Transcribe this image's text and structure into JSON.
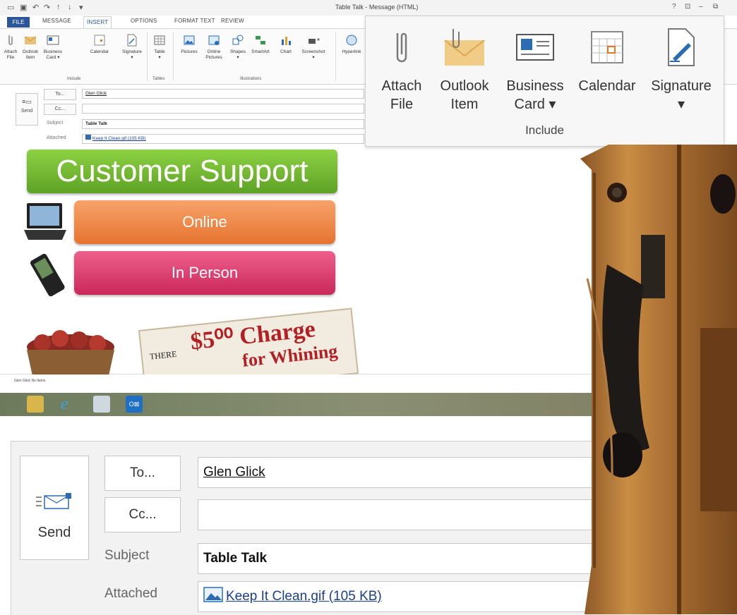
{
  "window": {
    "title": "Table Talk - Message (HTML)",
    "controls": [
      "?",
      "⊡",
      "–",
      "⧉"
    ]
  },
  "ribbon_tabs": [
    "FILE",
    "MESSAGE",
    "INSERT",
    "OPTIONS",
    "FORMAT TEXT",
    "REVIEW"
  ],
  "ribbon_small": {
    "include": [
      {
        "label": "Attach\nFile",
        "icon": "paperclip-icon"
      },
      {
        "label": "Outlook\nItem",
        "icon": "envelope-icon"
      },
      {
        "label": "Business\nCard ▾",
        "icon": "business-card-icon"
      },
      {
        "label": "Calendar",
        "icon": "calendar-icon"
      },
      {
        "label": "Signature\n▾",
        "icon": "signature-icon"
      }
    ],
    "include_group": "Include",
    "tables": [
      {
        "label": "Table\n▾",
        "icon": "table-icon"
      }
    ],
    "tables_group": "Tables",
    "illustrations": [
      {
        "label": "Pictures",
        "icon": "pictures-icon"
      },
      {
        "label": "Online\nPictures",
        "icon": "online-pictures-icon"
      },
      {
        "label": "Shapes\n▾",
        "icon": "shapes-icon"
      },
      {
        "label": "SmartArt",
        "icon": "smartart-icon"
      },
      {
        "label": "Chart",
        "icon": "chart-icon"
      },
      {
        "label": "Screenshot\n▾",
        "icon": "screenshot-icon"
      }
    ],
    "illustrations_group": "Illustrations",
    "hyperlink": "Hyperlink"
  },
  "callout_ribbon": {
    "buttons": [
      {
        "label": "Attach\nFile",
        "icon": "paperclip-icon"
      },
      {
        "label": "Outlook\nItem",
        "icon": "envelope-icon"
      },
      {
        "label": "Business\nCard ▾",
        "icon": "business-card-icon"
      },
      {
        "label": "Calendar",
        "icon": "calendar-icon"
      },
      {
        "label": "Signature\n▾",
        "icon": "signature-icon"
      }
    ],
    "group_label": "Include"
  },
  "header": {
    "send": "Send",
    "to_button": "To...",
    "cc_button": "Cc...",
    "to_value": "Glen Glick",
    "cc_value": "",
    "subject_label": "Subject",
    "subject_value": "Table Talk",
    "attached_label": "Attached",
    "attachment": "Keep It Clean.gif (105 KB)"
  },
  "message_body": {
    "banner": "Customer Support",
    "online": "Online",
    "in_person": "In Person",
    "sign_there": "THERE",
    "sign_amount": "$5⁰⁰ Charge",
    "sign_whining": "for Whining"
  },
  "status": {
    "text": "Glen Glick  No Items"
  },
  "colors": {
    "file_tab": "#2b579a",
    "banner_green": "#6fb32f",
    "online_orange": "#ef8a48",
    "in_person_pink": "#d83a6c"
  }
}
